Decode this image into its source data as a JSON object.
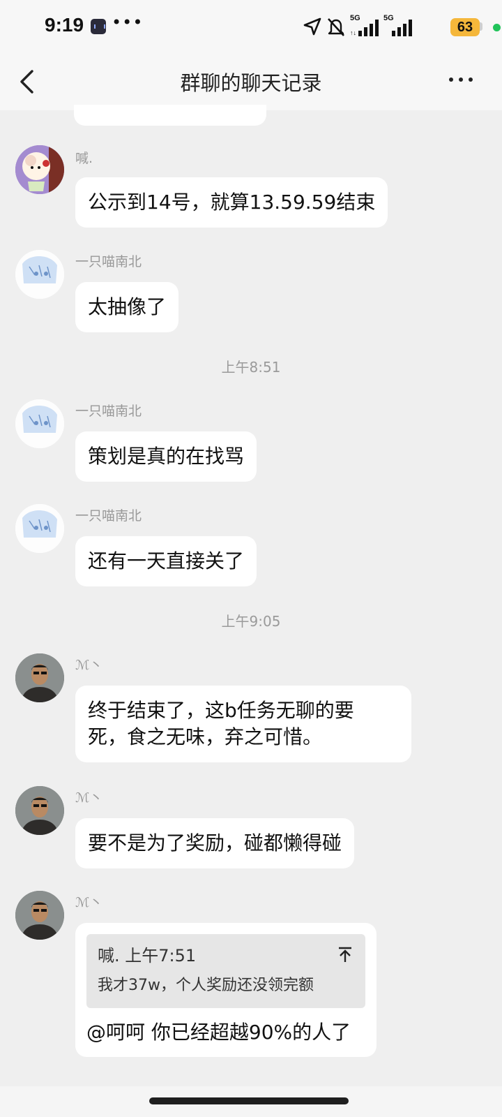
{
  "status_bar": {
    "time": "9:19",
    "network_1": "5G",
    "network_2": "5G",
    "battery": "63"
  },
  "nav": {
    "title": "群聊的聊天记录"
  },
  "messages": [
    {
      "sender": "喊.",
      "text": "公示到14号，就算13.59.59结束",
      "avatar": "cartoon-sheep-avatar"
    },
    {
      "sender": "一只喵南北",
      "text": "太抽像了",
      "avatar": "anime-girl-avatar"
    },
    {
      "separator": "上午8:51"
    },
    {
      "sender": "一只喵南北",
      "text": "策划是真的在找骂",
      "avatar": "anime-girl-avatar"
    },
    {
      "sender": "一只喵南北",
      "text": "还有一天直接关了",
      "avatar": "anime-girl-avatar"
    },
    {
      "separator": "上午9:05"
    },
    {
      "sender": "ℳ丶",
      "text_line1": "终于结束了，这b任务无聊的要",
      "text_line2": "死，食之无味，弃之可惜。",
      "avatar": "man-photo-avatar"
    },
    {
      "sender": "ℳ丶",
      "text": "要不是为了奖励，碰都懒得碰",
      "avatar": "man-photo-avatar"
    },
    {
      "sender": "ℳ丶",
      "avatar": "man-photo-avatar",
      "quote": {
        "head": "喊. 上午7:51",
        "text": "我才37w，个人奖励还没领完额"
      },
      "text": "@呵呵 你已经超越90%的人了"
    }
  ],
  "colors": {
    "background": "#efefef",
    "bubble": "#ffffff",
    "battery": "#f5b73b",
    "status_dot": "#21c35a"
  }
}
